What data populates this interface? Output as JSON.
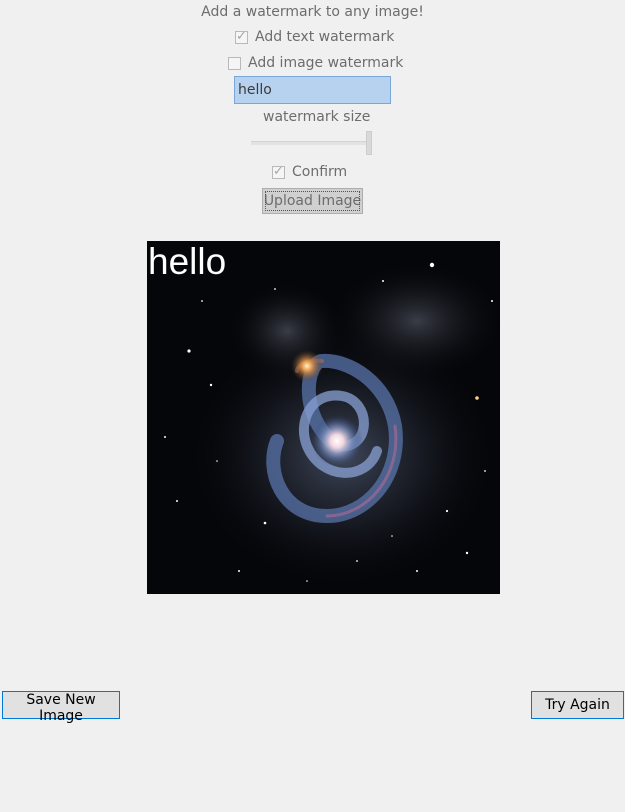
{
  "header": {
    "title": "Add a watermark to any image!"
  },
  "options": {
    "text_watermark": {
      "label": "Add text watermark",
      "checked": true
    },
    "image_watermark": {
      "label": "Add image watermark",
      "checked": false
    },
    "watermark_text": {
      "value": "hello"
    },
    "size_label": "watermark size",
    "size_level": 1.0,
    "confirm": {
      "label": "Confirm",
      "checked": true
    },
    "upload_label": "Upload Image"
  },
  "preview": {
    "watermark_text": "hello",
    "image_subject": "spiral galaxy"
  },
  "actions": {
    "save_label": "Save New Image",
    "try_again_label": "Try Again"
  },
  "colors": {
    "background": "#f0f0f0",
    "input_highlight": "#b7d2ef",
    "button_border_accent": "#0078d7"
  }
}
